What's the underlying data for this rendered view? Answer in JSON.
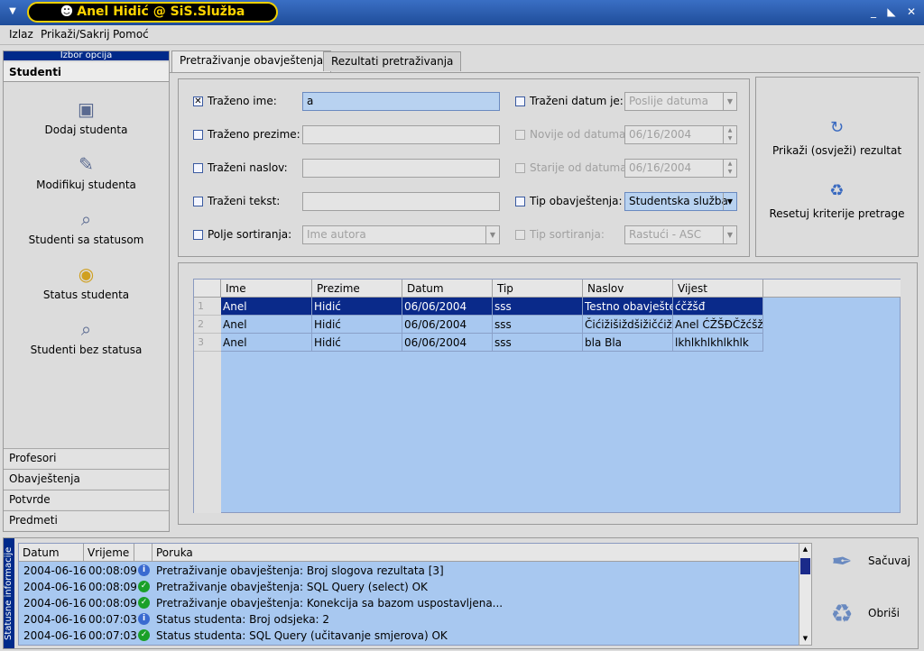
{
  "window": {
    "title": "Anel Hidić @ SiS.Služba"
  },
  "menu": [
    "Izlaz",
    "Prikaži/Sakrij",
    "Pomoć"
  ],
  "left_panel": {
    "header": "Izbor opcija",
    "section_title": "Studenti",
    "items": [
      {
        "label": "Dodaj studenta",
        "icon": "add-student-icon"
      },
      {
        "label": "Modifikuj studenta",
        "icon": "wrench-icon"
      },
      {
        "label": "Studenti sa statusom",
        "icon": "magnifier-icon"
      },
      {
        "label": "Status studenta",
        "icon": "status-icon"
      },
      {
        "label": "Studenti bez statusa",
        "icon": "search-users-icon"
      }
    ],
    "sections": [
      "Profesori",
      "Obavještenja",
      "Potvrde",
      "Predmeti"
    ]
  },
  "tabs": [
    "Pretraživanje obavještenja",
    "Rezultati pretraživanja"
  ],
  "search": {
    "name_label": "Traženo ime:",
    "name_value": "a",
    "surname_label": "Traženo prezime:",
    "title_label": "Traženi naslov:",
    "text_label": "Traženi tekst:",
    "sort_label": "Polje sortiranja:",
    "sort_value": "Ime autora",
    "date_label": "Traženi datum je:",
    "date_mode_value": "Poslije datuma",
    "newer_label": "Novije od datuma:",
    "newer_value": "06/16/2004",
    "older_label": "Starije od datuma:",
    "older_value": "06/16/2004",
    "type_label": "Tip obavještenja:",
    "type_value": "Studentska služba",
    "sort_type_label": "Tip sortiranja:",
    "sort_type_value": "Rastući - ASC"
  },
  "actions": {
    "show": "Prikaži (osvježi) rezultat",
    "reset": "Resetuj kriterije pretrage"
  },
  "results": {
    "columns": [
      "Ime",
      "Prezime",
      "Datum",
      "Tip",
      "Naslov",
      "Vijest"
    ],
    "rows": [
      {
        "n": "1",
        "cells": [
          "Anel",
          "Hidić",
          "06/06/2004",
          "sss",
          "Testno obavještenje",
          "ćčžšđ"
        ]
      },
      {
        "n": "2",
        "cells": [
          "Anel",
          "Hidić",
          "06/06/2004",
          "sss",
          "Čićižišiždšižičćiž",
          "Anel ĆŽŠĐČžćšž"
        ]
      },
      {
        "n": "3",
        "cells": [
          "Anel",
          "Hidić",
          "06/06/2004",
          "sss",
          "bla Bla",
          "lkhlkhlkhlkhlk"
        ]
      }
    ]
  },
  "status": {
    "vertical_label": "Statusne informacije",
    "columns": [
      "Datum",
      "Vrijeme",
      "Poruka"
    ],
    "rows": [
      {
        "date": "2004-06-16",
        "time": "00:08:09",
        "kind": "info",
        "msg": "Pretraživanje obavještenja: Broj slogova rezultata [3]"
      },
      {
        "date": "2004-06-16",
        "time": "00:08:09",
        "kind": "ok",
        "msg": "Pretraživanje obavještenja: SQL Query (select) OK"
      },
      {
        "date": "2004-06-16",
        "time": "00:08:09",
        "kind": "ok",
        "msg": "Pretraživanje obavještenja: Konekcija sa bazom uspostavljena..."
      },
      {
        "date": "2004-06-16",
        "time": "00:07:03",
        "kind": "info",
        "msg": "Status studenta: Broj odsjeka: 2"
      },
      {
        "date": "2004-06-16",
        "time": "00:07:03",
        "kind": "ok",
        "msg": "Status studenta: SQL Query (učitavanje smjerova) OK"
      }
    ],
    "save": "Sačuvaj",
    "delete": "Obriši"
  }
}
